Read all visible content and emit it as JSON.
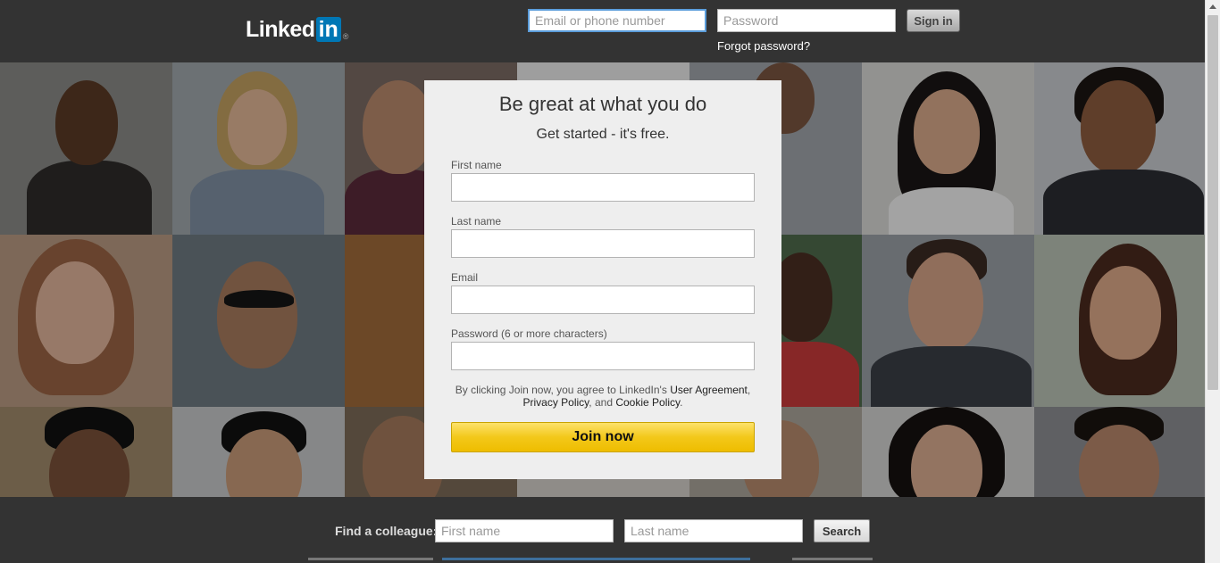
{
  "header": {
    "logo_text": "Linked",
    "logo_box": "in",
    "logo_reg": "®",
    "email_placeholder": "Email or phone number",
    "password_placeholder": "Password",
    "signin_label": "Sign in",
    "forgot_label": "Forgot password?"
  },
  "signup": {
    "title": "Be great at what you do",
    "subtitle": "Get started - it's free.",
    "first_name_label": "First name",
    "last_name_label": "Last name",
    "email_label": "Email",
    "password_label": "Password (6 or more characters)",
    "legal_prefix": "By clicking Join now, you agree to LinkedIn's ",
    "user_agreement": "User Agreement",
    "comma": ",",
    "privacy_policy": "Privacy Policy",
    "and_text": ", and ",
    "cookie_policy": "Cookie Policy",
    "period": ".",
    "join_label": "Join now"
  },
  "footer": {
    "find_label": "Find a colleague:",
    "first_placeholder": "First name",
    "last_placeholder": "Last name",
    "search_label": "Search"
  },
  "colors": {
    "brand_blue": "#0077b5",
    "join_yellow": "#f3c81a",
    "header_bg": "#333333",
    "card_bg": "#eeeeee"
  }
}
